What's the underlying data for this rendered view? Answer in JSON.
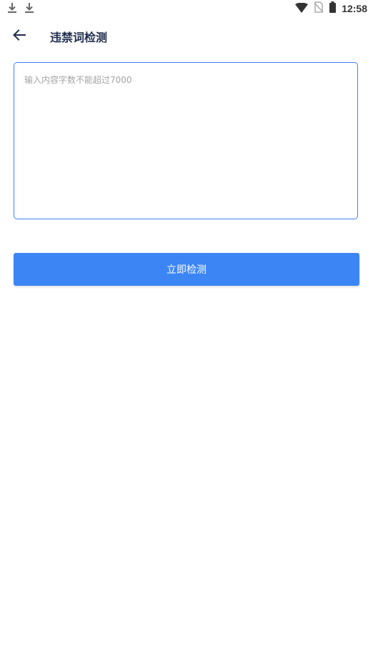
{
  "status_bar": {
    "time": "12:58",
    "icons": [
      "download-icon",
      "download-icon",
      "wifi-icon",
      "no-sim-icon",
      "battery-icon"
    ]
  },
  "toolbar": {
    "title": "违禁词检测",
    "back_icon": "arrow-left-icon"
  },
  "input": {
    "placeholder": "输入内容字数不能超过7000",
    "value": ""
  },
  "actions": {
    "detect_label": "立即检测"
  },
  "colors": {
    "accent": "#3c85f5",
    "title": "#1f2d4d",
    "placeholder": "#a4a4a4"
  }
}
